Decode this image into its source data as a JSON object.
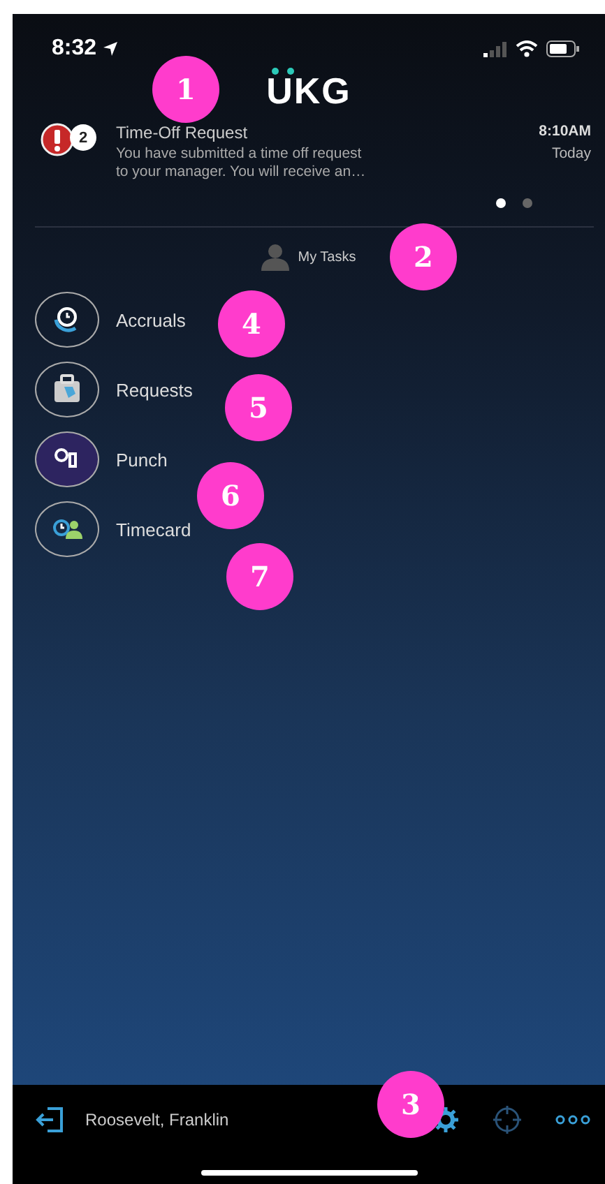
{
  "status_bar": {
    "time": "8:32"
  },
  "logo": {
    "text": "UKG"
  },
  "notification": {
    "count": "2",
    "title": "Time-Off Request",
    "message_lines": [
      "You have submitted a time off request",
      "to your manager.  You will receive an…"
    ],
    "time": "8:10AM",
    "day": "Today"
  },
  "pager": [
    {
      "selected": true
    },
    {
      "selected": false
    }
  ],
  "section": {
    "label": "My Tasks"
  },
  "menu": [
    {
      "kind": "accruals",
      "label": "Accruals"
    },
    {
      "kind": "requests",
      "label": "Requests"
    },
    {
      "kind": "punch",
      "label": "Punch"
    },
    {
      "kind": "timecard",
      "label": "Timecard"
    }
  ],
  "footer": {
    "user": "Roosevelt, Franklin"
  },
  "callouts": [
    "1",
    "2",
    "3",
    "4",
    "5",
    "6",
    "7"
  ]
}
